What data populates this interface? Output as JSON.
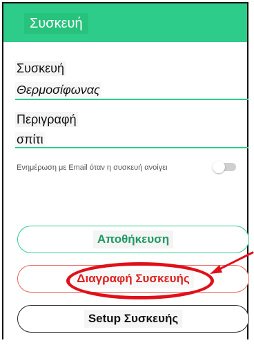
{
  "header": {
    "title": "Συσκευή"
  },
  "form": {
    "device_label": "Συσκευή",
    "device_value": "Θερμοσίφωνας",
    "description_label": "Περιγραφή",
    "description_value": "σπίτι",
    "email_toggle_label": "Ενημέρωση με Email όταν η συσκευή ανοίγει",
    "email_toggle_on": false
  },
  "buttons": {
    "save": "Αποθήκευση",
    "delete": "Διαγραφή Συσκευής",
    "setup": "Setup Συσκευής"
  },
  "colors": {
    "accent": "#2ecc8a",
    "danger": "#e02020",
    "annotation": "#e0101a"
  },
  "icons": [
    "annotation-arrow"
  ]
}
